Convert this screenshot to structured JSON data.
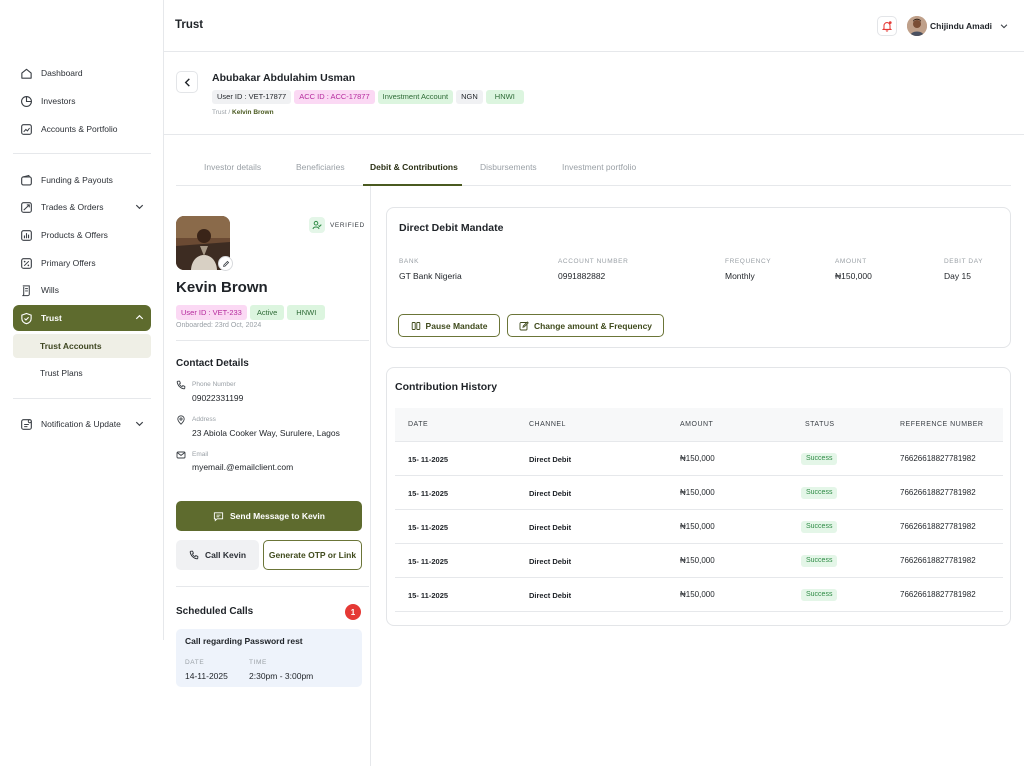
{
  "sidebar": {
    "items": [
      {
        "label": "Dashboard",
        "icon": "home-icon"
      },
      {
        "label": "Investors",
        "icon": "pie-icon"
      },
      {
        "label": "Accounts & Portfolio",
        "icon": "chart-icon"
      },
      {
        "label": "Funding & Payouts",
        "icon": "wallet-icon"
      },
      {
        "label": "Trades & Orders",
        "icon": "trend-icon"
      },
      {
        "label": "Products & Offers",
        "icon": "bars-icon"
      },
      {
        "label": "Primary Offers",
        "icon": "tag-icon"
      },
      {
        "label": "Wills",
        "icon": "scroll-icon"
      },
      {
        "label": "Trust",
        "icon": "shield-icon"
      }
    ],
    "sub_items": [
      "Trust Accounts",
      "Trust Plans"
    ],
    "notification_label": "Notification & Update"
  },
  "topbar": {
    "title": "Trust",
    "user_name": "Chijindu Amadi"
  },
  "header": {
    "name": "Abubakar Abdulahim Usman",
    "pills": [
      "User ID : VET-17877",
      "ACC ID : ACC-17877",
      "Investment Account",
      "NGN",
      "HNWI"
    ],
    "breadcrumb_root": "Trust",
    "breadcrumb_sep": "/",
    "breadcrumb_current": "Kelvin Brown"
  },
  "tabs": [
    "Investor details",
    "Beneficiaries",
    "Debit & Contributions",
    "Disbursements",
    "Investment portfolio"
  ],
  "profile": {
    "verified_label": "VERIFIED",
    "name": "Kevin Brown",
    "user_id": "User ID : VET-233",
    "status": "Active",
    "tier": "HNWI",
    "onboarded": "Onboarded: 23rd Oct, 2024",
    "contact_title": "Contact Details",
    "phone_label": "Phone Number",
    "phone": "09022331199",
    "address_label": "Address",
    "address": "23 Abiola Cooker Way, Surulere, Lagos",
    "email_label": "Email",
    "email": "myemail.@emailclient.com",
    "send_message": "Send Message to Kevin",
    "call": "Call Kevin",
    "otp": "Generate OTP or Link",
    "scheduled_title": "Scheduled Calls",
    "scheduled_count": "1",
    "call_title": "Call regarding Password rest",
    "date_label": "DATE",
    "date": "14-11-2025",
    "time_label": "TIME",
    "time": "2:30pm - 3:00pm"
  },
  "mandate": {
    "title": "Direct Debit Mandate",
    "fields": [
      {
        "label": "BANK",
        "value": "GT Bank Nigeria"
      },
      {
        "label": "ACCOUNT NUMBER",
        "value": "0991882882"
      },
      {
        "label": "FREQUENCY",
        "value": "Monthly"
      },
      {
        "label": "AMOUNT",
        "value": "₦150,000"
      },
      {
        "label": "DEBIT DAY",
        "value": "Day 15"
      }
    ],
    "pause_label": "Pause Mandate",
    "change_label": "Change amount & Frequency"
  },
  "history": {
    "title": "Contribution History",
    "headers": [
      "DATE",
      "CHANNEL",
      "AMOUNT",
      "STATUS",
      "REFERENCE NUMBER"
    ],
    "rows": [
      [
        "15- 11-2025",
        "Direct Debit",
        "₦150,000",
        "Success",
        "76626618827781982"
      ],
      [
        "15- 11-2025",
        "Direct Debit",
        "₦150,000",
        "Success",
        "76626618827781982"
      ],
      [
        "15- 11-2025",
        "Direct Debit",
        "₦150,000",
        "Success",
        "76626618827781982"
      ],
      [
        "15- 11-2025",
        "Direct Debit",
        "₦150,000",
        "Success",
        "76626618827781982"
      ],
      [
        "15- 11-2025",
        "Direct Debit",
        "₦150,000",
        "Success",
        "76626618827781982"
      ]
    ]
  },
  "colors": {
    "accent": "#5e6b2e",
    "success_bg": "#e4f6e8",
    "success_text": "#2e8b45",
    "pink_bg": "#fbd9f4",
    "green_bg": "#dcf5df"
  }
}
